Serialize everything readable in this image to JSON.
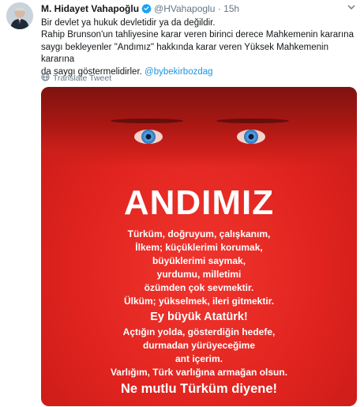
{
  "tweet": {
    "author_name": "M. Hidayet Vahapoğlu",
    "handle": "@HVahapoglu",
    "separator": "·",
    "time": "15h",
    "text_lines": [
      "Bir devlet ya hukuk devletidir ya da değildir.",
      "Rahip Brunson'un tahliyesine karar veren birinci derece Mahkemenin kararına",
      "saygı bekleyenler \"Andımız\" hakkında karar veren Yüksek Mahkemenin kararına",
      "da saygı göstermelidirler."
    ],
    "mention": "@bybekirbozdag",
    "translate_label": "Translate Tweet",
    "icons": {
      "verified": "verified-badge-icon",
      "more": "chevron-down-icon",
      "translate": "globe-icon"
    }
  },
  "poster": {
    "title": "ANDIMIZ",
    "lines": [
      "Türküm, doğruyum, çalışkanım,",
      "İlkem; küçüklerimi korumak,",
      "büyüklerimi saymak,",
      "yurdumu, milletimi",
      "özümden çok sevmektir.",
      "Ülküm; yükselmek, ileri gitmektir.",
      "Ey büyük Atatürk!",
      "Açtığın yolda, gösterdiğin hedefe,",
      "durmadan yürüyeceğime",
      "ant içerim.",
      "Varlığım, Türk varlığına armağan olsun."
    ],
    "footer": "Ne mutlu Türküm diyene!",
    "colors": {
      "background": "#e0231e",
      "text": "#ffffff",
      "eyes": "#2a6fb6"
    }
  },
  "colors": {
    "link": "#1b95e0",
    "muted": "#657786",
    "verified": "#1da1f2"
  }
}
